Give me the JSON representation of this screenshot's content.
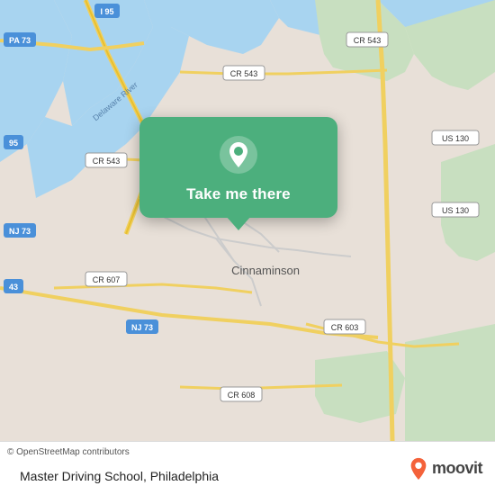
{
  "map": {
    "alt": "Map of Cinnaminson, Philadelphia area"
  },
  "popup": {
    "button_label": "Take me there",
    "pin_icon": "location-pin-icon"
  },
  "bottom_bar": {
    "copyright": "© OpenStreetMap contributors",
    "location_label": "Master Driving School, Philadelphia",
    "brand": "moovit"
  }
}
